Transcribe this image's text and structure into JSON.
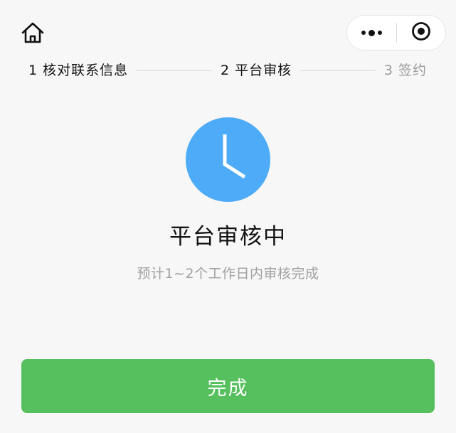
{
  "nav": {
    "home_icon": "home-icon",
    "more_icon": "more-icon",
    "close_icon": "target-icon"
  },
  "steps": [
    {
      "label": "1 核对联系信息",
      "state": "done"
    },
    {
      "label": "2 平台审核",
      "state": "current"
    },
    {
      "label": "3 签约",
      "state": "pending"
    }
  ],
  "status": {
    "icon": "clock-icon",
    "title": "平台审核中",
    "description": "预计1~2个工作日内审核完成"
  },
  "actions": {
    "done_label": "完成"
  },
  "colors": {
    "accent_blue": "#4dabf7",
    "primary_green": "#56c05f",
    "step_pending": "#9b9b9b"
  }
}
